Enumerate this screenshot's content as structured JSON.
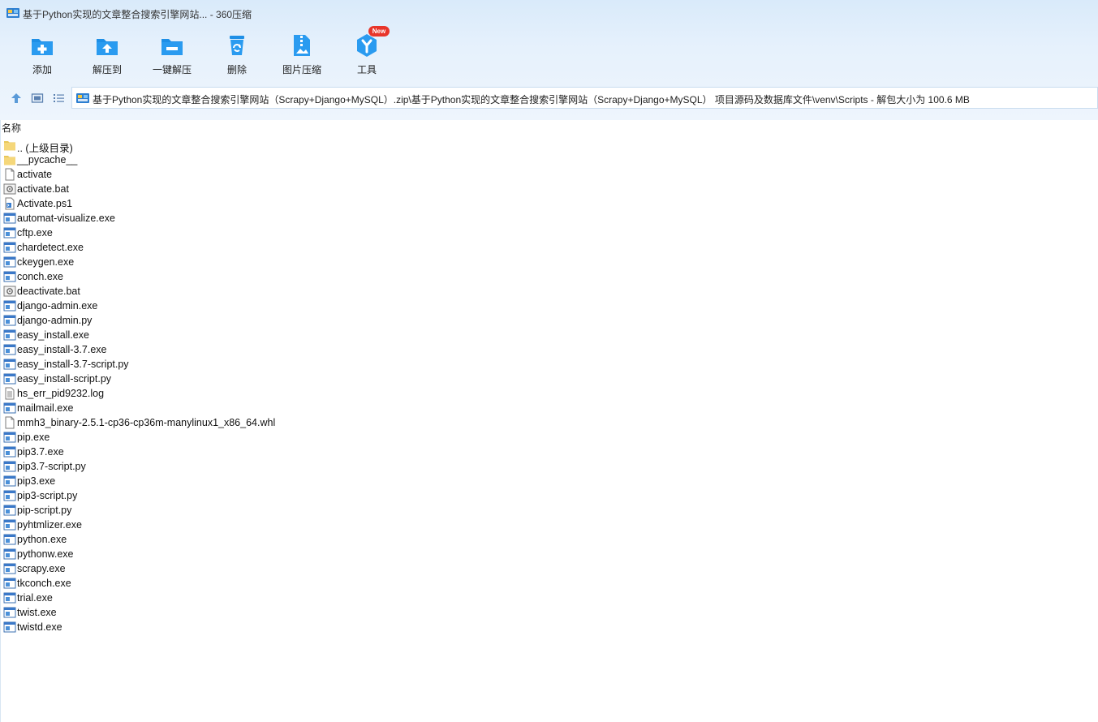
{
  "window": {
    "title": "基于Python实现的文章整合搜索引擎网站... - 360压缩"
  },
  "toolbar": {
    "items": [
      {
        "label": "添加",
        "icon": "add-icon"
      },
      {
        "label": "解压到",
        "icon": "extract-to-icon"
      },
      {
        "label": "一键解压",
        "icon": "one-click-extract-icon"
      },
      {
        "label": "删除",
        "icon": "delete-icon"
      },
      {
        "label": "图片压缩",
        "icon": "image-compress-icon"
      },
      {
        "label": "工具",
        "icon": "tools-icon"
      }
    ],
    "new_badge": "New"
  },
  "navbar": {
    "icons": [
      "up-arrow-icon",
      "thumbnail-view-icon",
      "list-view-icon"
    ],
    "path": "基于Python实现的文章整合搜索引擎网站（Scrapy+Django+MySQL）.zip\\基于Python实现的文章整合搜索引擎网站（Scrapy+Django+MySQL） 项目源码及数据库文件\\venv\\Scripts - 解包大小为 100.6 MB"
  },
  "columns": {
    "name": "名称"
  },
  "files": [
    {
      "name": ".. (上级目录)",
      "type": "folder"
    },
    {
      "name": "__pycache__",
      "type": "folder"
    },
    {
      "name": "activate",
      "type": "file"
    },
    {
      "name": "activate.bat",
      "type": "bat"
    },
    {
      "name": "Activate.ps1",
      "type": "ps1"
    },
    {
      "name": "automat-visualize.exe",
      "type": "exe"
    },
    {
      "name": "cftp.exe",
      "type": "exe"
    },
    {
      "name": "chardetect.exe",
      "type": "exe"
    },
    {
      "name": "ckeygen.exe",
      "type": "exe"
    },
    {
      "name": "conch.exe",
      "type": "exe"
    },
    {
      "name": "deactivate.bat",
      "type": "bat"
    },
    {
      "name": "django-admin.exe",
      "type": "exe"
    },
    {
      "name": "django-admin.py",
      "type": "exe"
    },
    {
      "name": "easy_install.exe",
      "type": "exe"
    },
    {
      "name": "easy_install-3.7.exe",
      "type": "exe"
    },
    {
      "name": "easy_install-3.7-script.py",
      "type": "exe"
    },
    {
      "name": "easy_install-script.py",
      "type": "exe"
    },
    {
      "name": "hs_err_pid9232.log",
      "type": "log"
    },
    {
      "name": "mailmail.exe",
      "type": "exe"
    },
    {
      "name": "mmh3_binary-2.5.1-cp36-cp36m-manylinux1_x86_64.whl",
      "type": "file"
    },
    {
      "name": "pip.exe",
      "type": "exe"
    },
    {
      "name": "pip3.7.exe",
      "type": "exe"
    },
    {
      "name": "pip3.7-script.py",
      "type": "exe"
    },
    {
      "name": "pip3.exe",
      "type": "exe"
    },
    {
      "name": "pip3-script.py",
      "type": "exe"
    },
    {
      "name": "pip-script.py",
      "type": "exe"
    },
    {
      "name": "pyhtmlizer.exe",
      "type": "exe"
    },
    {
      "name": "python.exe",
      "type": "exe"
    },
    {
      "name": "pythonw.exe",
      "type": "exe"
    },
    {
      "name": "scrapy.exe",
      "type": "exe"
    },
    {
      "name": "tkconch.exe",
      "type": "exe"
    },
    {
      "name": "trial.exe",
      "type": "exe"
    },
    {
      "name": "twist.exe",
      "type": "exe"
    },
    {
      "name": "twistd.exe",
      "type": "exe"
    }
  ],
  "colors": {
    "toolbar_blue": "#1e8fe6",
    "folder_yellow": "#f5d77a",
    "badge_red": "#e8352a",
    "chrome_bg": "#e3eefb"
  }
}
